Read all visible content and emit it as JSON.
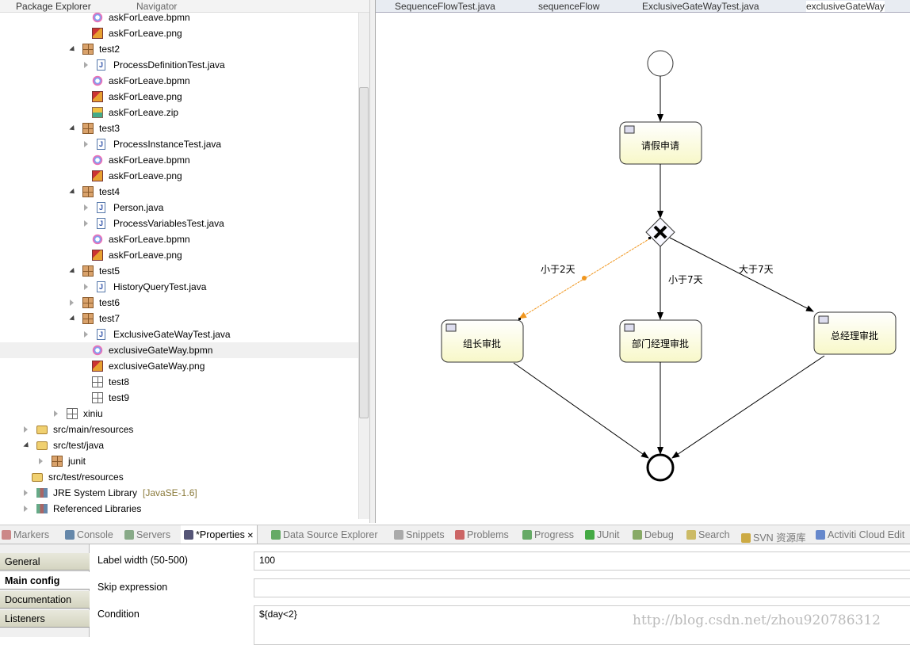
{
  "left_tabs": [
    "Package Explorer",
    "Navigator"
  ],
  "editor_tabs": [
    "SequenceFlowTest.java",
    "sequenceFlow",
    "ExclusiveGateWayTest.java",
    "exclusiveGateWay"
  ],
  "tree": [
    {
      "label": "askForLeave.bpmn",
      "icon": "bpmn-icon",
      "level": 5
    },
    {
      "label": "askForLeave.png",
      "icon": "png-icon",
      "level": 5
    },
    {
      "label": "test2",
      "icon": "package-icon",
      "level": 3,
      "expanded": true
    },
    {
      "label": "ProcessDefinitionTest.java",
      "icon": "java-icon",
      "level": 4,
      "expanded": false
    },
    {
      "label": "askForLeave.bpmn",
      "icon": "bpmn-icon",
      "level": 5
    },
    {
      "label": "askForLeave.png",
      "icon": "png-icon",
      "level": 5
    },
    {
      "label": "askForLeave.zip",
      "icon": "zip-icon",
      "level": 5
    },
    {
      "label": "test3",
      "icon": "package-icon",
      "level": 3,
      "expanded": true
    },
    {
      "label": "ProcessInstanceTest.java",
      "icon": "java-icon",
      "level": 4,
      "expanded": false
    },
    {
      "label": "askForLeave.bpmn",
      "icon": "bpmn-icon",
      "level": 5
    },
    {
      "label": "askForLeave.png",
      "icon": "png-icon",
      "level": 5
    },
    {
      "label": "test4",
      "icon": "package-icon",
      "level": 3,
      "expanded": true
    },
    {
      "label": "Person.java",
      "icon": "java-icon",
      "level": 4,
      "expanded": false
    },
    {
      "label": "ProcessVariablesTest.java",
      "icon": "java-icon",
      "level": 4,
      "expanded": false
    },
    {
      "label": "askForLeave.bpmn",
      "icon": "bpmn-icon",
      "level": 5
    },
    {
      "label": "askForLeave.png",
      "icon": "png-icon",
      "level": 5
    },
    {
      "label": "test5",
      "icon": "package-icon",
      "level": 3,
      "expanded": true
    },
    {
      "label": "HistoryQueryTest.java",
      "icon": "java-icon",
      "level": 4,
      "expanded": false
    },
    {
      "label": "test6",
      "icon": "package-icon",
      "level": 3,
      "expanded": false
    },
    {
      "label": "test7",
      "icon": "package-icon",
      "level": 3,
      "expanded": true
    },
    {
      "label": "ExclusiveGateWayTest.java",
      "icon": "java-icon",
      "level": 4,
      "expanded": false
    },
    {
      "label": "exclusiveGateWay.bpmn",
      "icon": "bpmn-icon",
      "level": 5,
      "selected": true
    },
    {
      "label": "exclusiveGateWay.png",
      "icon": "png-icon",
      "level": 5
    },
    {
      "label": "test8",
      "icon": "empty-package-icon",
      "level": 5
    },
    {
      "label": "test9",
      "icon": "empty-package-icon",
      "level": 5
    },
    {
      "label": "xiniu",
      "icon": "empty-package-icon",
      "level": 2,
      "expanded": false
    },
    {
      "label": "src/main/resources",
      "icon": "folder-icon",
      "level": 0,
      "expanded": false
    },
    {
      "label": "src/test/java",
      "icon": "folder-icon",
      "level": 0,
      "expanded": true
    },
    {
      "label": "junit",
      "icon": "package-icon",
      "level": 1,
      "expanded": false
    },
    {
      "label": "src/test/resources",
      "icon": "folder-icon",
      "level": 1
    },
    {
      "label": "JRE System Library",
      "suffix": "[JavaSE-1.6]",
      "icon": "library-icon",
      "level": 0,
      "expanded": false
    },
    {
      "label": "Referenced Libraries",
      "icon": "library-icon",
      "level": 0,
      "expanded": false
    }
  ],
  "diagram": {
    "tasks": [
      "请假申请",
      "组长审批",
      "部门经理审批",
      "总经理审批"
    ],
    "flows": {
      "lt2": "小于2天",
      "lt7": "小于7天",
      "gt7": "大于7天"
    },
    "selected_flow_color": "#f0961e",
    "task_fill": "#fbfbd8"
  },
  "bottom_tabs": [
    "Markers",
    "Console",
    "Servers",
    "*Properties",
    "Data Source Explorer",
    "Snippets",
    "Problems",
    "Progress",
    "JUnit",
    "Debug",
    "Search",
    "SVN 资源库",
    "Activiti Cloud Edit"
  ],
  "properties": {
    "tabs": [
      "General",
      "Main config",
      "Documentation",
      "Listeners"
    ],
    "selected_tab": "Main config",
    "fields": [
      {
        "label": "Label width (50-500)",
        "value": "100"
      },
      {
        "label": "Skip expression",
        "value": ""
      },
      {
        "label": "Condition",
        "value": "${day<2}"
      }
    ]
  },
  "watermark": "http://blog.csdn.net/zhou920786312"
}
